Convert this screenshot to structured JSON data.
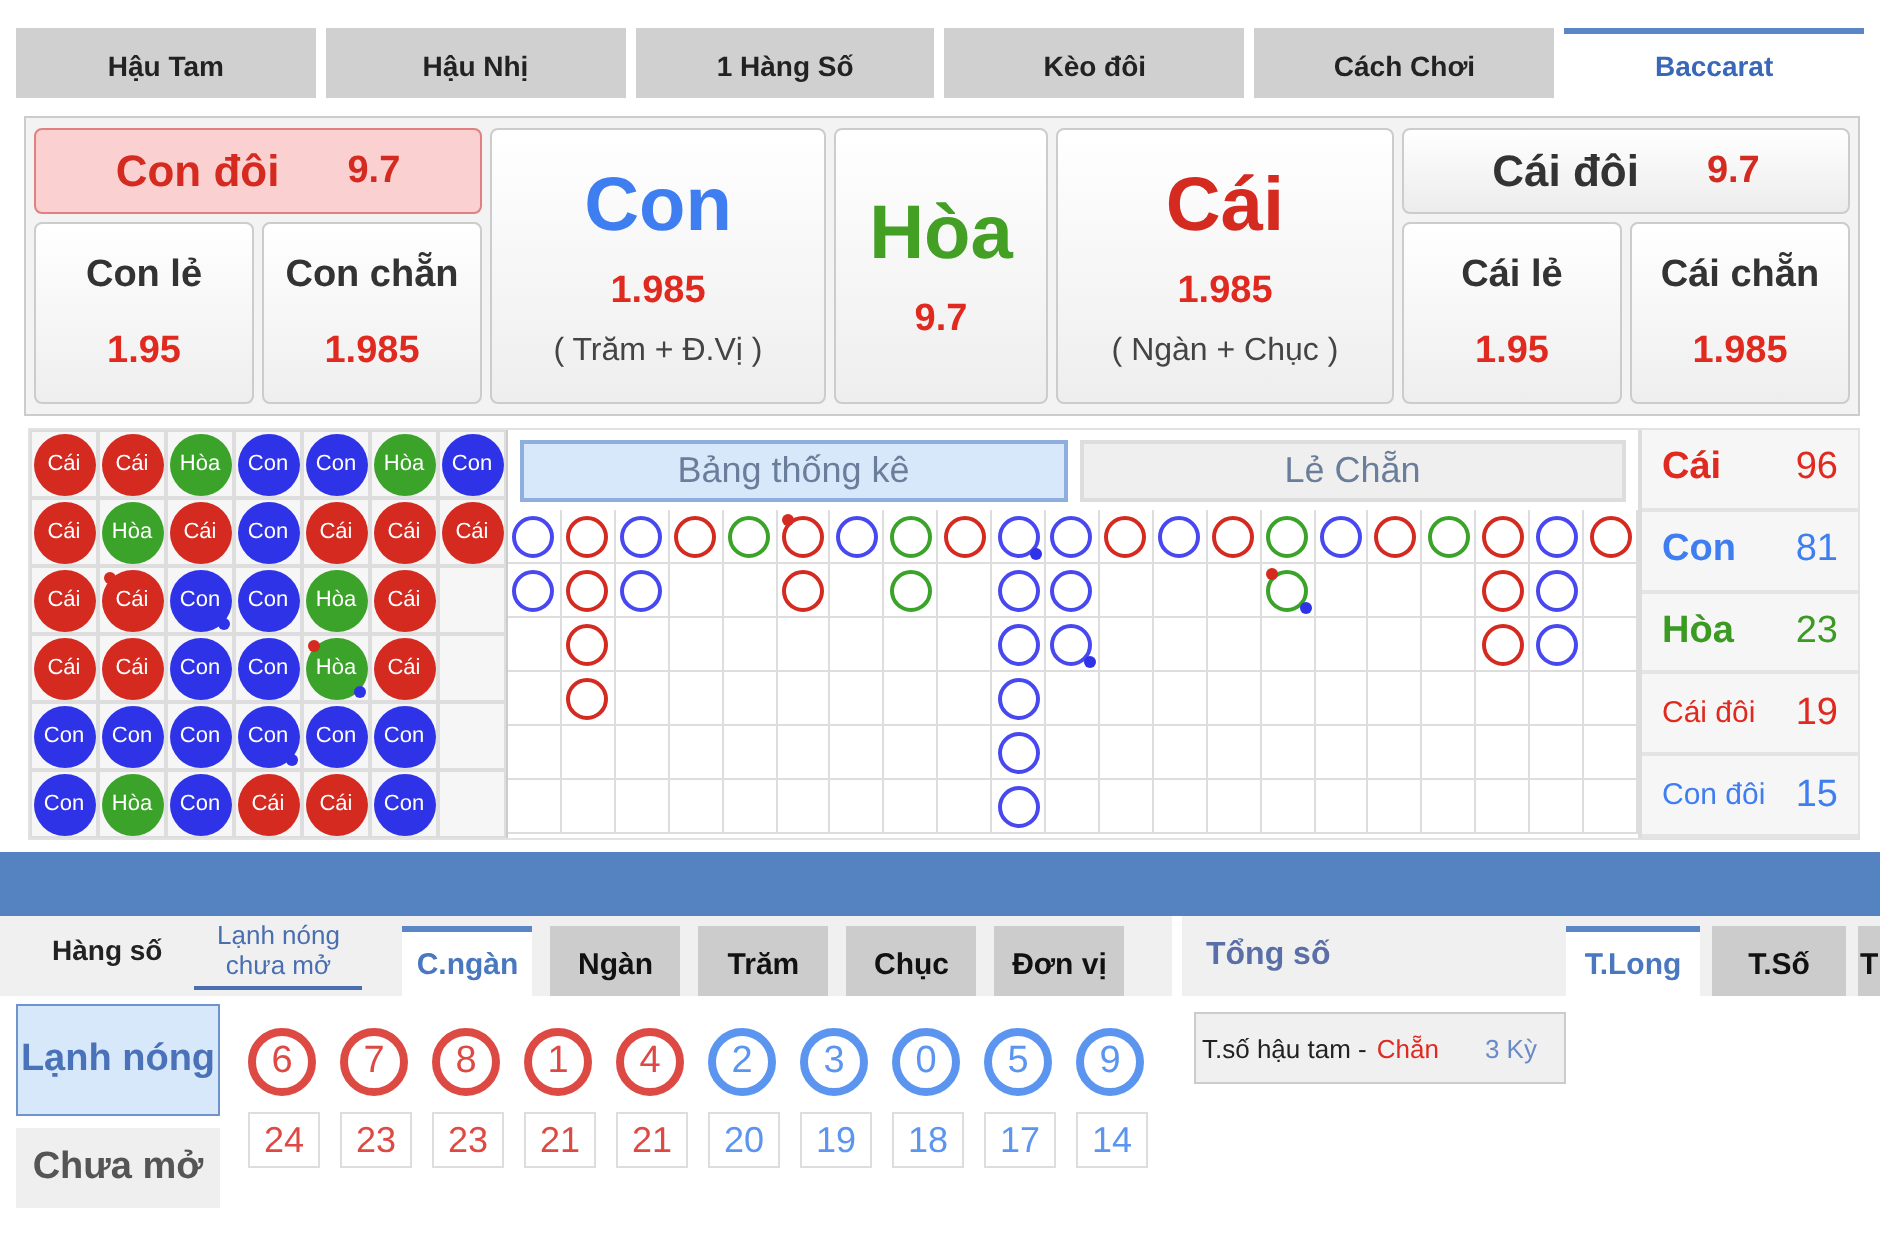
{
  "top_tabs": [
    {
      "label": "Hậu Tam",
      "selected": false
    },
    {
      "label": "Hậu Nhị",
      "selected": false
    },
    {
      "label": "1 Hàng Số",
      "selected": false
    },
    {
      "label": "Kèo đôi",
      "selected": false
    },
    {
      "label": "Cách Chơi",
      "selected": false
    },
    {
      "label": "Baccarat",
      "selected": true
    }
  ],
  "bet_board": {
    "left": {
      "pair": {
        "label": "Con đôi",
        "odds": "9.7",
        "selected": true
      },
      "cards": [
        {
          "label": "Con lẻ",
          "odds": "1.95"
        },
        {
          "label": "Con chẵn",
          "odds": "1.985"
        }
      ]
    },
    "main": [
      {
        "label": "Con",
        "odds": "1.985",
        "note": "( Trăm + Đ.Vị )",
        "kind": "con"
      },
      {
        "label": "Hòa",
        "odds": "9.7",
        "kind": "hoa"
      },
      {
        "label": "Cái",
        "odds": "1.985",
        "note": "( Ngàn + Chục )",
        "kind": "cai"
      }
    ],
    "right": {
      "pair": {
        "label": "Cái đôi",
        "odds": "9.7",
        "selected": false
      },
      "cards": [
        {
          "label": "Cái lẻ",
          "odds": "1.95"
        },
        {
          "label": "Cái chẵn",
          "odds": "1.985"
        }
      ]
    }
  },
  "bead_road": [
    [
      {
        "label": "Cái",
        "kind": "cai",
        "banker_pair": false,
        "player_pair": false
      },
      {
        "label": "Cái",
        "kind": "cai",
        "banker_pair": false,
        "player_pair": false
      },
      {
        "label": "Cái",
        "kind": "cai",
        "banker_pair": false,
        "player_pair": false
      },
      {
        "label": "Cái",
        "kind": "cai",
        "banker_pair": false,
        "player_pair": false
      },
      {
        "label": "Con",
        "kind": "con",
        "banker_pair": false,
        "player_pair": false
      },
      {
        "label": "Con",
        "kind": "con",
        "banker_pair": false,
        "player_pair": false
      }
    ],
    [
      {
        "label": "Cái",
        "kind": "cai",
        "banker_pair": false,
        "player_pair": false
      },
      {
        "label": "Hòa",
        "kind": "hoa",
        "banker_pair": false,
        "player_pair": false
      },
      {
        "label": "Cái",
        "kind": "cai",
        "banker_pair": true,
        "player_pair": false
      },
      {
        "label": "Cái",
        "kind": "cai",
        "banker_pair": false,
        "player_pair": false
      },
      {
        "label": "Con",
        "kind": "con",
        "banker_pair": false,
        "player_pair": false
      },
      {
        "label": "Hòa",
        "kind": "hoa",
        "banker_pair": false,
        "player_pair": false
      }
    ],
    [
      {
        "label": "Hòa",
        "kind": "hoa",
        "banker_pair": false,
        "player_pair": false
      },
      {
        "label": "Cái",
        "kind": "cai",
        "banker_pair": false,
        "player_pair": false
      },
      {
        "label": "Con",
        "kind": "con",
        "banker_pair": false,
        "player_pair": true
      },
      {
        "label": "Con",
        "kind": "con",
        "banker_pair": false,
        "player_pair": false
      },
      {
        "label": "Con",
        "kind": "con",
        "banker_pair": false,
        "player_pair": false
      },
      {
        "label": "Con",
        "kind": "con",
        "banker_pair": false,
        "player_pair": false
      }
    ],
    [
      {
        "label": "Con",
        "kind": "con",
        "banker_pair": false,
        "player_pair": false
      },
      {
        "label": "Con",
        "kind": "con",
        "banker_pair": false,
        "player_pair": false
      },
      {
        "label": "Con",
        "kind": "con",
        "banker_pair": false,
        "player_pair": false
      },
      {
        "label": "Con",
        "kind": "con",
        "banker_pair": false,
        "player_pair": false
      },
      {
        "label": "Con",
        "kind": "con",
        "banker_pair": false,
        "player_pair": true
      },
      {
        "label": "Cái",
        "kind": "cai",
        "banker_pair": false,
        "player_pair": false
      }
    ],
    [
      {
        "label": "Con",
        "kind": "con",
        "banker_pair": false,
        "player_pair": false
      },
      {
        "label": "Cái",
        "kind": "cai",
        "banker_pair": false,
        "player_pair": false
      },
      {
        "label": "Hòa",
        "kind": "hoa",
        "banker_pair": false,
        "player_pair": false
      },
      {
        "label": "Hòa",
        "kind": "hoa",
        "banker_pair": true,
        "player_pair": true
      },
      {
        "label": "Con",
        "kind": "con",
        "banker_pair": false,
        "player_pair": false
      },
      {
        "label": "Cái",
        "kind": "cai",
        "banker_pair": false,
        "player_pair": false
      }
    ],
    [
      {
        "label": "Hòa",
        "kind": "hoa",
        "banker_pair": false,
        "player_pair": false
      },
      {
        "label": "Cái",
        "kind": "cai",
        "banker_pair": false,
        "player_pair": false
      },
      {
        "label": "Cái",
        "kind": "cai",
        "banker_pair": false,
        "player_pair": false
      },
      {
        "label": "Cái",
        "kind": "cai",
        "banker_pair": false,
        "player_pair": false
      },
      {
        "label": "Con",
        "kind": "con",
        "banker_pair": false,
        "player_pair": false
      },
      {
        "label": "Con",
        "kind": "con",
        "banker_pair": false,
        "player_pair": false
      }
    ],
    [
      {
        "label": "Con",
        "kind": "con",
        "banker_pair": false,
        "player_pair": false
      },
      {
        "label": "Cái",
        "kind": "cai",
        "banker_pair": false,
        "player_pair": false
      }
    ]
  ],
  "road_tabs": [
    {
      "label": "Bảng thống kê",
      "selected": true
    },
    {
      "label": "Lẻ Chẵn",
      "selected": false
    }
  ],
  "big_road": [
    [
      {
        "kind": "con",
        "banker_pair": false,
        "player_pair": false
      },
      {
        "kind": "con",
        "banker_pair": false,
        "player_pair": false
      }
    ],
    [
      {
        "kind": "cai",
        "banker_pair": false,
        "player_pair": false
      },
      {
        "kind": "cai",
        "banker_pair": false,
        "player_pair": false
      },
      {
        "kind": "cai",
        "banker_pair": false,
        "player_pair": false
      },
      {
        "kind": "cai",
        "banker_pair": false,
        "player_pair": false
      }
    ],
    [
      {
        "kind": "con",
        "banker_pair": false,
        "player_pair": false
      },
      {
        "kind": "con",
        "banker_pair": false,
        "player_pair": false
      }
    ],
    [
      {
        "kind": "cai",
        "banker_pair": false,
        "player_pair": false
      }
    ],
    [
      {
        "kind": "hoa",
        "banker_pair": false,
        "player_pair": false
      }
    ],
    [
      {
        "kind": "cai",
        "banker_pair": true,
        "player_pair": false
      },
      {
        "kind": "cai",
        "banker_pair": false,
        "player_pair": false
      }
    ],
    [
      {
        "kind": "con",
        "banker_pair": false,
        "player_pair": false
      }
    ],
    [
      {
        "kind": "hoa",
        "banker_pair": false,
        "player_pair": false
      },
      {
        "kind": "hoa",
        "banker_pair": false,
        "player_pair": false
      }
    ],
    [
      {
        "kind": "cai",
        "banker_pair": false,
        "player_pair": false
      }
    ],
    [
      {
        "kind": "con",
        "banker_pair": false,
        "player_pair": true
      },
      {
        "kind": "con",
        "banker_pair": false,
        "player_pair": false
      },
      {
        "kind": "con",
        "banker_pair": false,
        "player_pair": false
      },
      {
        "kind": "con",
        "banker_pair": false,
        "player_pair": false
      },
      {
        "kind": "con",
        "banker_pair": false,
        "player_pair": false
      },
      {
        "kind": "con",
        "banker_pair": false,
        "player_pair": false
      }
    ],
    [
      {
        "kind": "con",
        "banker_pair": false,
        "player_pair": false
      },
      {
        "kind": "con",
        "banker_pair": false,
        "player_pair": false
      },
      {
        "kind": "con",
        "banker_pair": false,
        "player_pair": true
      }
    ],
    [
      {
        "kind": "cai",
        "banker_pair": false,
        "player_pair": false
      }
    ],
    [
      {
        "kind": "con",
        "banker_pair": false,
        "player_pair": false
      }
    ],
    [
      {
        "kind": "cai",
        "banker_pair": false,
        "player_pair": false
      }
    ],
    [
      {
        "kind": "hoa",
        "banker_pair": false,
        "player_pair": false
      },
      {
        "kind": "hoa",
        "banker_pair": true,
        "player_pair": true
      }
    ],
    [
      {
        "kind": "con",
        "banker_pair": false,
        "player_pair": false
      }
    ],
    [
      {
        "kind": "cai",
        "banker_pair": false,
        "player_pair": false
      }
    ],
    [
      {
        "kind": "hoa",
        "banker_pair": false,
        "player_pair": false
      }
    ],
    [
      {
        "kind": "cai",
        "banker_pair": false,
        "player_pair": false
      },
      {
        "kind": "cai",
        "banker_pair": false,
        "player_pair": false
      },
      {
        "kind": "cai",
        "banker_pair": false,
        "player_pair": false
      }
    ],
    [
      {
        "kind": "con",
        "banker_pair": false,
        "player_pair": false
      },
      {
        "kind": "con",
        "banker_pair": false,
        "player_pair": false
      },
      {
        "kind": "con",
        "banker_pair": false,
        "player_pair": false
      }
    ],
    [
      {
        "kind": "cai",
        "banker_pair": false,
        "player_pair": false
      }
    ]
  ],
  "stats": [
    {
      "label": "Cái",
      "value": "96",
      "kind": "cai"
    },
    {
      "label": "Con",
      "value": "81",
      "kind": "con"
    },
    {
      "label": "Hòa",
      "value": "23",
      "kind": "hoa"
    },
    {
      "label": "Cái đôi",
      "value": "19",
      "kind": "cai_pair"
    },
    {
      "label": "Con đôi",
      "value": "15",
      "kind": "con_pair"
    }
  ],
  "mode_tabs": [
    {
      "label": "Hàng số",
      "selected": false
    },
    {
      "label": "Lạnh nóng chưa mở",
      "selected": true
    }
  ],
  "position_tabs": [
    {
      "label": "C.ngàn",
      "selected": true
    },
    {
      "label": "Ngàn",
      "selected": false
    },
    {
      "label": "Trăm",
      "selected": false
    },
    {
      "label": "Chục",
      "selected": false
    },
    {
      "label": "Đơn vị",
      "selected": false
    }
  ],
  "side_buttons": [
    {
      "label": "Lạnh nóng",
      "selected": true
    },
    {
      "label": "Chưa mở",
      "selected": false
    }
  ],
  "numbers": [
    {
      "digit": "6",
      "count": "24",
      "kind": "hot"
    },
    {
      "digit": "7",
      "count": "23",
      "kind": "hot"
    },
    {
      "digit": "8",
      "count": "23",
      "kind": "hot"
    },
    {
      "digit": "1",
      "count": "21",
      "kind": "hot"
    },
    {
      "digit": "4",
      "count": "21",
      "kind": "hot"
    },
    {
      "digit": "2",
      "count": "20",
      "kind": "cold"
    },
    {
      "digit": "3",
      "count": "19",
      "kind": "cold"
    },
    {
      "digit": "0",
      "count": "18",
      "kind": "cold"
    },
    {
      "digit": "5",
      "count": "17",
      "kind": "cold"
    },
    {
      "digit": "9",
      "count": "14",
      "kind": "cold"
    }
  ],
  "totals": {
    "title": "Tổng số",
    "tabs": [
      {
        "label": "T.Long",
        "selected": true
      },
      {
        "label": "T.Số",
        "selected": false
      },
      {
        "label": "T",
        "selected": false
      }
    ],
    "rows": [
      {
        "label": "T.số hậu tam -",
        "value": "Chẵn",
        "periods": "3 Kỳ"
      }
    ]
  }
}
